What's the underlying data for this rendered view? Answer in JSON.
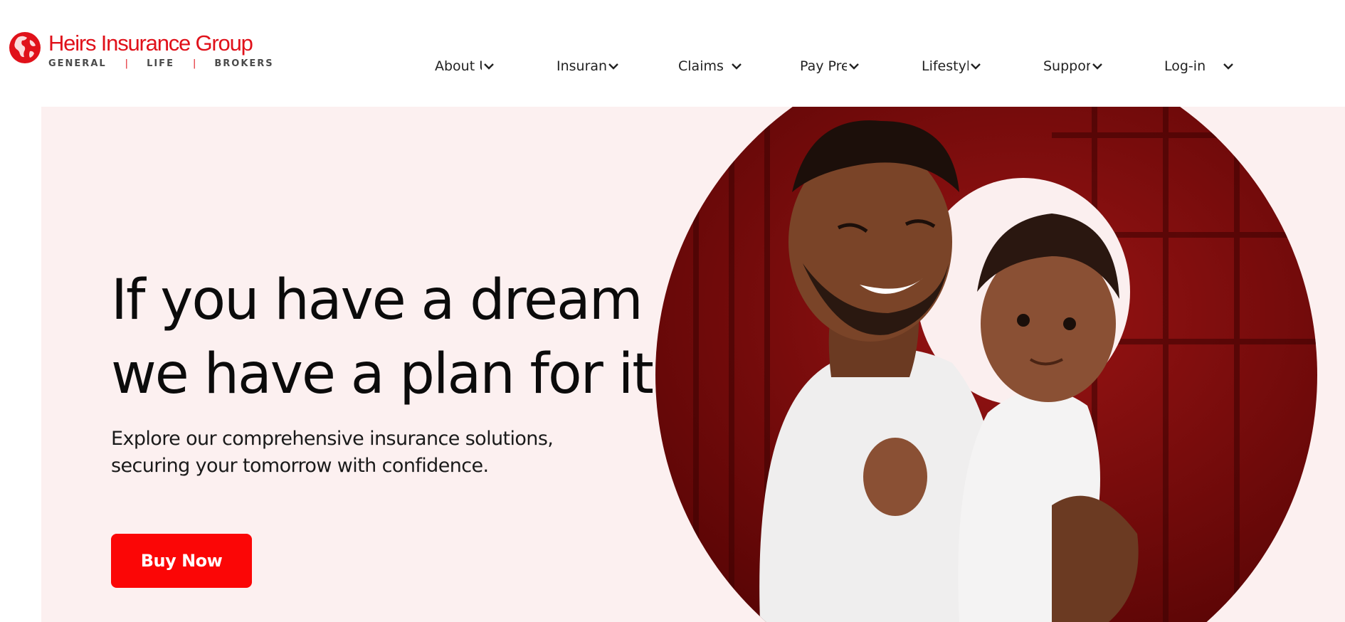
{
  "brand": {
    "name": "Heirs Insurance Group",
    "divisions": [
      "GENERAL",
      "LIFE",
      "BROKERS"
    ],
    "separator": "|",
    "accent_color": "#e0111a"
  },
  "nav": {
    "items": [
      {
        "label": "About Us",
        "icon": "chevron-down-icon"
      },
      {
        "label": "Insurance",
        "icon": "chevron-down-icon"
      },
      {
        "label": "Claims",
        "icon": "chevron-down-icon"
      },
      {
        "label": "Pay Premium",
        "icon": "chevron-down-icon"
      },
      {
        "label": "Lifestyle",
        "icon": "chevron-down-icon"
      },
      {
        "label": "Support",
        "icon": "chevron-down-icon"
      },
      {
        "label": "Log-in",
        "icon": "chevron-down-icon"
      }
    ]
  },
  "hero": {
    "headline_line1": "If you have a dream",
    "headline_line2": "we have a plan for it.",
    "subtext_line1": "Explore our comprehensive insurance solutions,",
    "subtext_line2": "securing your tomorrow with confidence.",
    "cta_label": "Buy Now",
    "cta_color": "#fb0606",
    "background_color": "#fcf0f0",
    "image": "father-holding-baby-photo"
  }
}
